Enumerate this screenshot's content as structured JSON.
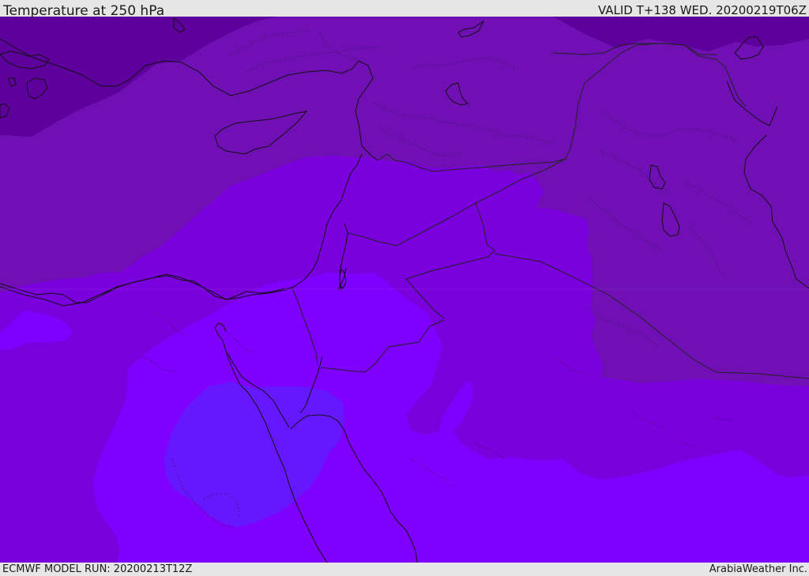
{
  "header": {
    "title": "Temperature at 250 hPa",
    "valid_time": "VALID T+138 WED. 20200219T06Z"
  },
  "footer": {
    "model_run": "ECMWF MODEL RUN: 20200213T12Z",
    "provider": "ArabiaWeather Inc."
  },
  "map": {
    "colors": {
      "darkest": "#5e009c",
      "dark": "#7010b4",
      "mid": "#7a00dd",
      "bright": "#7f00ff",
      "core": "#6518ff",
      "coast_line": "#111111",
      "border_line": "#222222",
      "dotted_line": "#3b1a63"
    }
  }
}
